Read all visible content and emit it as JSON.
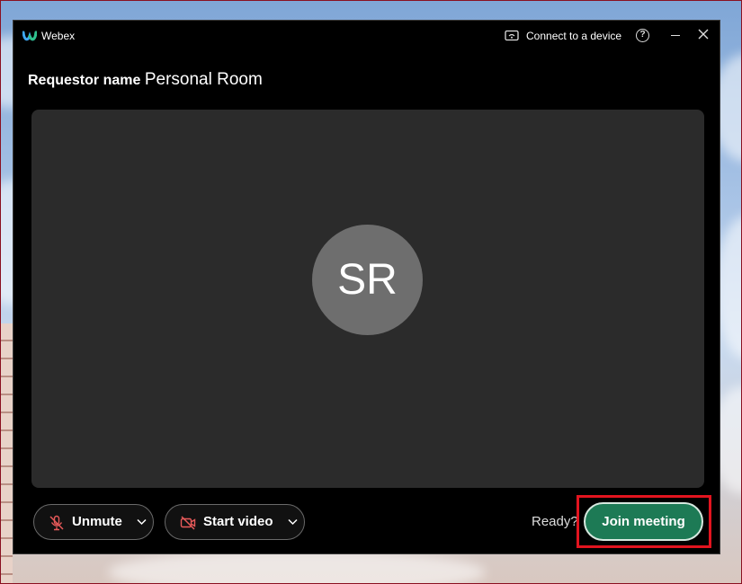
{
  "window": {
    "app_name": "Webex",
    "connect_label": "Connect to a device"
  },
  "meeting": {
    "requestor_label": "Requestor name",
    "room_name": "Personal Room",
    "avatar_initials": "SR"
  },
  "controls": {
    "unmute_label": "Unmute",
    "video_label": "Start video",
    "ready_label": "Ready?",
    "join_label": "Join meeting"
  },
  "colors": {
    "join_button": "#1d7a55",
    "highlight": "#e2141f",
    "muted_icon": "#e85a5a"
  },
  "icons": {
    "logo": "webex-logo-icon",
    "connect": "connect-device-icon",
    "help": "help-icon",
    "minimize": "minimize-icon",
    "close": "close-icon",
    "mic": "microphone-muted-icon",
    "video": "video-off-icon",
    "chevron": "chevron-down-icon"
  }
}
